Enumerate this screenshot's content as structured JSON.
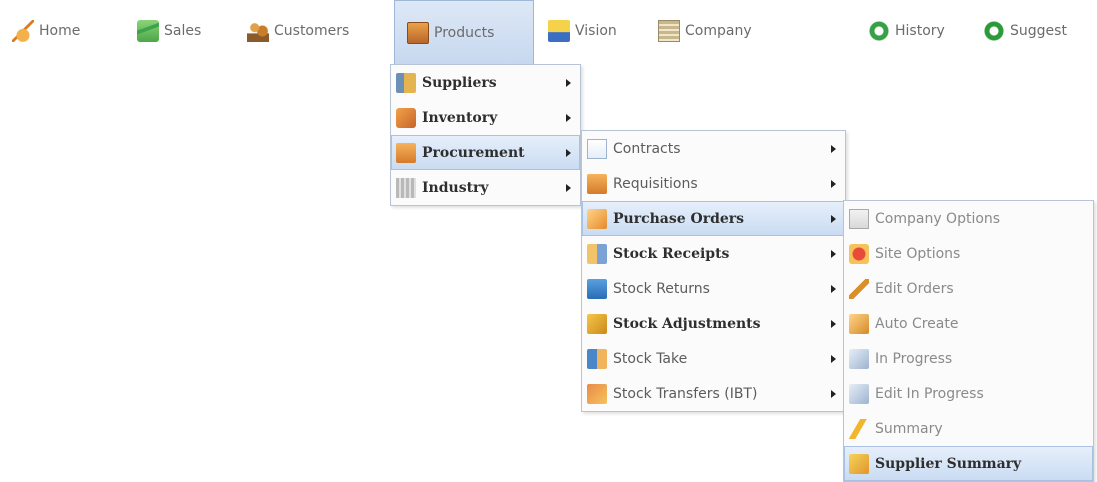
{
  "topnav": {
    "items": [
      {
        "label": "Home",
        "icon": "home-icon"
      },
      {
        "label": "Sales",
        "icon": "sales-chart-icon"
      },
      {
        "label": "Customers",
        "icon": "customers-icon"
      },
      {
        "label": "Products",
        "icon": "products-icon",
        "active": true
      },
      {
        "label": "Vision",
        "icon": "vision-icon"
      },
      {
        "label": "Company",
        "icon": "company-icon"
      },
      {
        "label": "History",
        "icon": "history-icon"
      },
      {
        "label": "Suggest",
        "icon": "suggest-icon"
      }
    ]
  },
  "menu_products": {
    "items": [
      {
        "label": "Suppliers",
        "bold": true,
        "submenu": true
      },
      {
        "label": "Inventory",
        "bold": true,
        "submenu": true
      },
      {
        "label": "Procurement",
        "bold": true,
        "submenu": true,
        "active": true
      },
      {
        "label": "Industry",
        "bold": true,
        "submenu": true
      }
    ]
  },
  "menu_procurement": {
    "items": [
      {
        "label": "Contracts",
        "submenu": true
      },
      {
        "label": "Requisitions",
        "submenu": true
      },
      {
        "label": "Purchase Orders",
        "bold": true,
        "submenu": true,
        "active": true
      },
      {
        "label": "Stock Receipts",
        "bold": true,
        "submenu": true
      },
      {
        "label": "Stock Returns",
        "submenu": true
      },
      {
        "label": "Stock Adjustments",
        "bold": true,
        "submenu": true
      },
      {
        "label": "Stock Take",
        "submenu": true
      },
      {
        "label": "Stock Transfers (IBT)",
        "submenu": true
      }
    ]
  },
  "menu_purchase_orders": {
    "items": [
      {
        "label": "Company Options"
      },
      {
        "label": "Site Options"
      },
      {
        "label": "Edit Orders"
      },
      {
        "label": "Auto Create"
      },
      {
        "label": "In Progress"
      },
      {
        "label": "Edit In Progress"
      },
      {
        "label": "Summary"
      },
      {
        "label": "Supplier Summary",
        "bold": true,
        "active": true
      }
    ]
  },
  "colors": {
    "active_gradient_top": "#e7f0fb",
    "active_gradient_bottom": "#c9dbf2",
    "menu_border": "#b7c4d6",
    "nav_text": "#6b6b6b"
  }
}
